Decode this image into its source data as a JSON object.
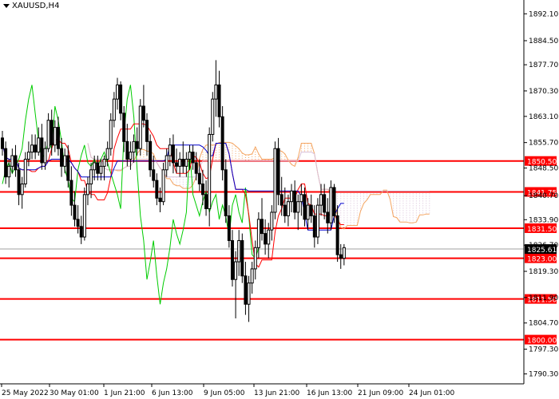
{
  "window": {
    "symbol_timeframe": "XAUUSD,H4"
  },
  "colors": {
    "background": "#ffffff",
    "axis": "#000000",
    "grid": "#c8c8c8",
    "level_line": "#ff0000",
    "level_label_bg": "#ff0000",
    "level_label_text": "#ffffff",
    "price_label_bg": "#000000",
    "current_price_line": "#a0a0a0",
    "candle": "#000000",
    "tenkan": "#ff0000",
    "kijun": "#0000cc",
    "chikou": "#00cc00",
    "cloud_bull": "#f4a460",
    "cloud_bear": "#d8bfd8"
  },
  "price_axis": {
    "ticks": [
      "1892.10",
      "1884.50",
      "1877.70",
      "1870.30",
      "1863.10",
      "1855.70",
      "1848.50",
      "1840.70",
      "1833.90",
      "1826.70",
      "1819.30",
      "1811.90",
      "1804.70",
      "1797.30",
      "1790.30"
    ]
  },
  "time_axis": {
    "ticks": [
      "25 May 2022",
      "30 May 01:00",
      "1 Jun 21:00",
      "6 Jun 13:00",
      "9 Jun 05:00",
      "13 Jun 21:00",
      "16 Jun 13:00",
      "21 Jun 09:00",
      "24 Jun 01:00"
    ]
  },
  "levels": [
    {
      "label": "1850.50",
      "value": 1850.5
    },
    {
      "label": "1841.75",
      "value": 1841.75
    },
    {
      "label": "1831.50",
      "value": 1831.5
    },
    {
      "label": "1823.00",
      "value": 1823.0
    },
    {
      "label": "1811.50",
      "value": 1811.5
    },
    {
      "label": "1800.00",
      "value": 1800.0
    }
  ],
  "current_price": {
    "label": "1825.61",
    "value": 1825.61
  },
  "chart_data": {
    "type": "candlestick",
    "ylim": [
      1787.5,
      1896.0
    ],
    "xlim": [
      0,
      158
    ],
    "candles": [
      [
        0,
        1857,
        1859,
        1852,
        1854
      ],
      [
        1,
        1854,
        1856,
        1844,
        1846
      ],
      [
        2,
        1846,
        1851,
        1843,
        1849
      ],
      [
        3,
        1849,
        1854,
        1847,
        1852
      ],
      [
        4,
        1852,
        1855,
        1846,
        1848
      ],
      [
        5,
        1848,
        1850,
        1838,
        1841
      ],
      [
        6,
        1841,
        1846,
        1837,
        1844
      ],
      [
        7,
        1844,
        1853,
        1843,
        1851
      ],
      [
        8,
        1851,
        1856,
        1849,
        1853
      ],
      [
        9,
        1853,
        1858,
        1851,
        1855
      ],
      [
        10,
        1855,
        1858,
        1851,
        1853
      ],
      [
        11,
        1853,
        1860,
        1852,
        1857
      ],
      [
        12,
        1857,
        1861,
        1848,
        1850
      ],
      [
        13,
        1850,
        1856,
        1848,
        1854
      ],
      [
        14,
        1854,
        1864,
        1853,
        1862
      ],
      [
        15,
        1862,
        1865,
        1852,
        1855
      ],
      [
        16,
        1855,
        1862,
        1853,
        1860
      ],
      [
        17,
        1860,
        1863,
        1852,
        1854
      ],
      [
        18,
        1854,
        1857,
        1846,
        1849
      ],
      [
        19,
        1849,
        1854,
        1847,
        1852
      ],
      [
        20,
        1852,
        1855,
        1843,
        1845
      ],
      [
        21,
        1845,
        1849,
        1835,
        1838
      ],
      [
        22,
        1838,
        1842,
        1832,
        1834
      ],
      [
        23,
        1834,
        1838,
        1830,
        1832
      ],
      [
        24,
        1832,
        1835,
        1827,
        1829
      ],
      [
        25,
        1829,
        1843,
        1828,
        1841
      ],
      [
        26,
        1841,
        1846,
        1838,
        1844
      ],
      [
        27,
        1844,
        1850,
        1840,
        1848
      ],
      [
        28,
        1848,
        1852,
        1845,
        1850
      ],
      [
        29,
        1850,
        1852,
        1845,
        1847
      ],
      [
        30,
        1847,
        1851,
        1845,
        1849
      ],
      [
        31,
        1849,
        1852,
        1845,
        1851
      ],
      [
        32,
        1851,
        1856,
        1849,
        1854
      ],
      [
        33,
        1854,
        1864,
        1852,
        1862
      ],
      [
        34,
        1862,
        1870,
        1860,
        1868
      ],
      [
        35,
        1868,
        1874,
        1865,
        1872
      ],
      [
        36,
        1872,
        1873,
        1862,
        1864
      ],
      [
        37,
        1864,
        1866,
        1853,
        1856
      ],
      [
        38,
        1856,
        1861,
        1849,
        1851
      ],
      [
        39,
        1851,
        1856,
        1848,
        1853
      ],
      [
        40,
        1853,
        1858,
        1850,
        1856
      ],
      [
        41,
        1856,
        1860,
        1852,
        1854
      ],
      [
        42,
        1854,
        1868,
        1852,
        1866
      ],
      [
        43,
        1866,
        1872,
        1860,
        1862
      ],
      [
        44,
        1862,
        1864,
        1852,
        1856
      ],
      [
        45,
        1856,
        1858,
        1846,
        1848
      ],
      [
        46,
        1848,
        1852,
        1843,
        1845
      ],
      [
        47,
        1845,
        1847,
        1838,
        1840
      ],
      [
        48,
        1840,
        1843,
        1836,
        1839
      ],
      [
        49,
        1839,
        1850,
        1838,
        1848
      ],
      [
        50,
        1848,
        1854,
        1846,
        1852
      ],
      [
        51,
        1852,
        1857,
        1849,
        1855
      ],
      [
        52,
        1855,
        1858,
        1847,
        1850
      ],
      [
        53,
        1850,
        1854,
        1847,
        1849
      ],
      [
        54,
        1849,
        1853,
        1846,
        1851
      ],
      [
        55,
        1851,
        1856,
        1847,
        1849
      ],
      [
        56,
        1849,
        1853,
        1846,
        1851
      ],
      [
        57,
        1851,
        1855,
        1848,
        1853
      ],
      [
        58,
        1853,
        1855,
        1848,
        1850
      ],
      [
        59,
        1850,
        1853,
        1845,
        1847
      ],
      [
        60,
        1847,
        1851,
        1842,
        1844
      ],
      [
        61,
        1844,
        1848,
        1838,
        1841
      ],
      [
        62,
        1841,
        1845,
        1835,
        1837
      ],
      [
        63,
        1837,
        1860,
        1832,
        1858
      ],
      [
        64,
        1858,
        1870,
        1856,
        1868
      ],
      [
        65,
        1868,
        1879,
        1863,
        1872
      ],
      [
        66,
        1872,
        1876,
        1860,
        1863
      ],
      [
        67,
        1863,
        1866,
        1845,
        1848
      ],
      [
        68,
        1848,
        1851,
        1833,
        1835
      ],
      [
        69,
        1835,
        1838,
        1826,
        1828
      ],
      [
        70,
        1828,
        1831,
        1815,
        1817
      ],
      [
        71,
        1817,
        1825,
        1806,
        1822
      ],
      [
        72,
        1822,
        1831,
        1818,
        1828
      ],
      [
        73,
        1828,
        1830,
        1816,
        1818
      ],
      [
        74,
        1818,
        1822,
        1807,
        1810
      ],
      [
        75,
        1810,
        1818,
        1805,
        1816
      ],
      [
        76,
        1816,
        1822,
        1813,
        1820
      ],
      [
        77,
        1820,
        1828,
        1817,
        1826
      ],
      [
        78,
        1826,
        1836,
        1823,
        1834
      ],
      [
        79,
        1834,
        1840,
        1828,
        1830
      ],
      [
        80,
        1830,
        1834,
        1824,
        1827
      ],
      [
        81,
        1827,
        1833,
        1823,
        1831
      ],
      [
        82,
        1831,
        1838,
        1828,
        1836
      ],
      [
        83,
        1836,
        1856,
        1834,
        1854
      ],
      [
        84,
        1854,
        1857,
        1838,
        1841
      ],
      [
        85,
        1841,
        1846,
        1835,
        1838
      ],
      [
        86,
        1838,
        1843,
        1833,
        1835
      ],
      [
        87,
        1835,
        1841,
        1832,
        1839
      ],
      [
        88,
        1839,
        1844,
        1836,
        1842
      ],
      [
        89,
        1842,
        1845,
        1834,
        1836
      ],
      [
        90,
        1836,
        1841,
        1831,
        1839
      ],
      [
        91,
        1839,
        1844,
        1835,
        1841
      ],
      [
        92,
        1841,
        1843,
        1832,
        1834
      ],
      [
        93,
        1834,
        1840,
        1831,
        1838
      ],
      [
        94,
        1838,
        1841,
        1833,
        1835
      ],
      [
        95,
        1835,
        1838,
        1826,
        1829
      ],
      [
        96,
        1829,
        1840,
        1827,
        1838
      ],
      [
        97,
        1838,
        1844,
        1835,
        1841
      ],
      [
        98,
        1841,
        1844,
        1834,
        1836
      ],
      [
        99,
        1836,
        1840,
        1830,
        1833
      ],
      [
        100,
        1833,
        1845,
        1831,
        1843
      ],
      [
        101,
        1843,
        1844,
        1833,
        1835
      ],
      [
        102,
        1835,
        1838,
        1822,
        1824
      ],
      [
        103,
        1824,
        1827,
        1820,
        1823
      ],
      [
        104,
        1823,
        1827,
        1821,
        1826
      ]
    ],
    "series": [
      {
        "name": "Tenkan-sen"
      },
      {
        "name": "Kijun-sen"
      },
      {
        "name": "Chikou Span"
      },
      {
        "name": "Senkou Span A"
      },
      {
        "name": "Senkou Span B"
      }
    ]
  }
}
